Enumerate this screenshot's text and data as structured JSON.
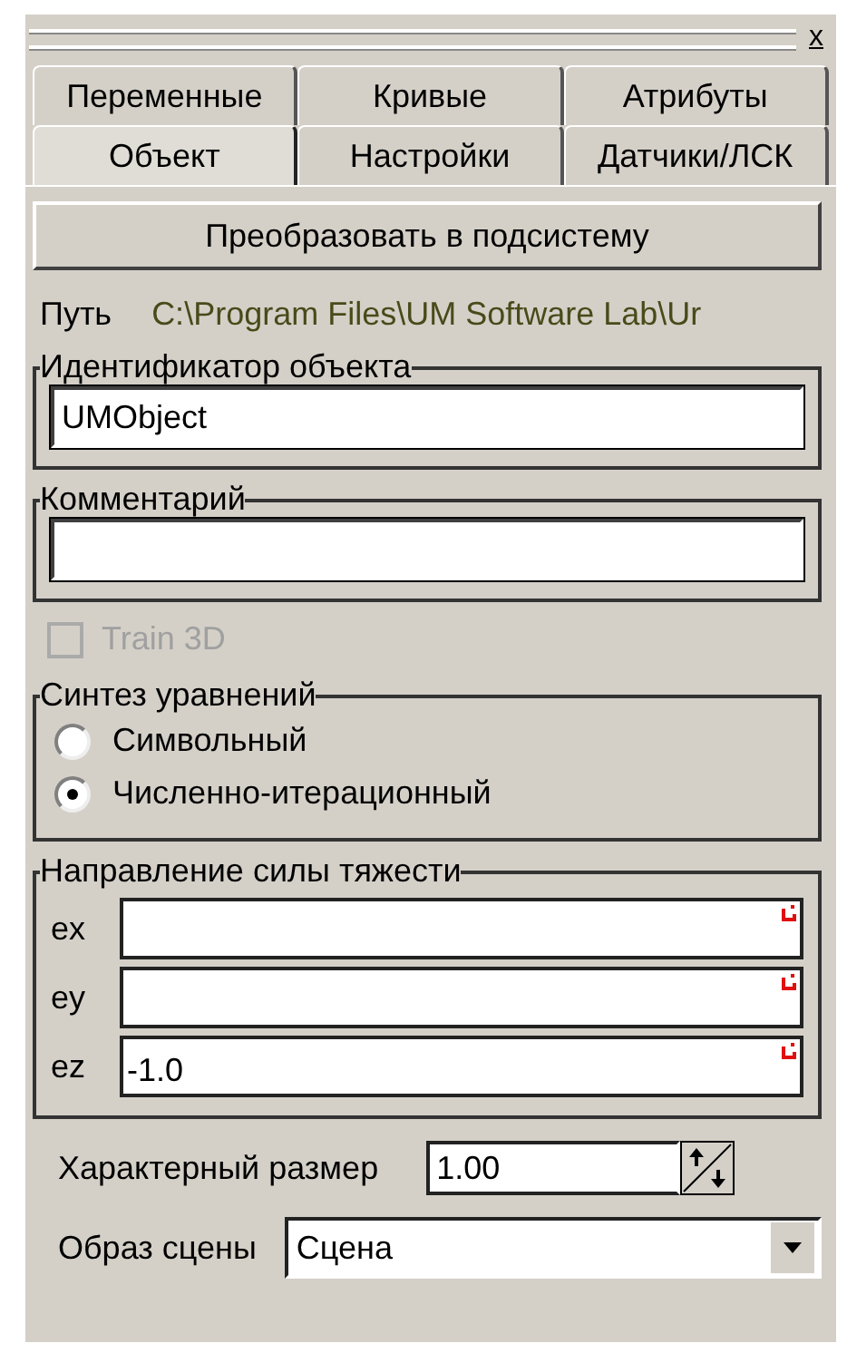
{
  "panel": {
    "close": "x"
  },
  "tab_rows": [
    {
      "tabs": [
        {
          "label": "Переменные",
          "selected": false
        },
        {
          "label": "Кривые",
          "selected": false
        },
        {
          "label": "Атрибуты",
          "selected": false
        }
      ]
    },
    {
      "tabs": [
        {
          "label": "Объект",
          "selected": true
        },
        {
          "label": "Настройки",
          "selected": false
        },
        {
          "label": "Датчики/ЛСК",
          "selected": false
        }
      ]
    }
  ],
  "convert_button": "Преобразовать в подсистему",
  "path": {
    "label": "Путь",
    "value": "C:\\Program Files\\UM Software Lab\\Ur"
  },
  "identifier": {
    "title": "Идентификатор объекта",
    "value": "UMObject"
  },
  "comment": {
    "title": "Комментарий"
  },
  "train3d": {
    "label": "Train 3D",
    "checked": false,
    "disabled": true
  },
  "synthesis": {
    "title": "Синтез уравнений",
    "options": [
      {
        "label": "Символьный",
        "selected": false
      },
      {
        "label": "Численно-итерационный",
        "selected": true
      }
    ]
  },
  "gravity": {
    "title": "Направление силы тяжести",
    "fields": [
      {
        "label": "ex"
      },
      {
        "label": "ey"
      },
      {
        "label": "ez",
        "value": "-1.0"
      }
    ]
  },
  "size": {
    "label": "Характерный размер",
    "value": "1.00"
  },
  "scene": {
    "label": "Образ сцены",
    "value": "Сцена"
  }
}
